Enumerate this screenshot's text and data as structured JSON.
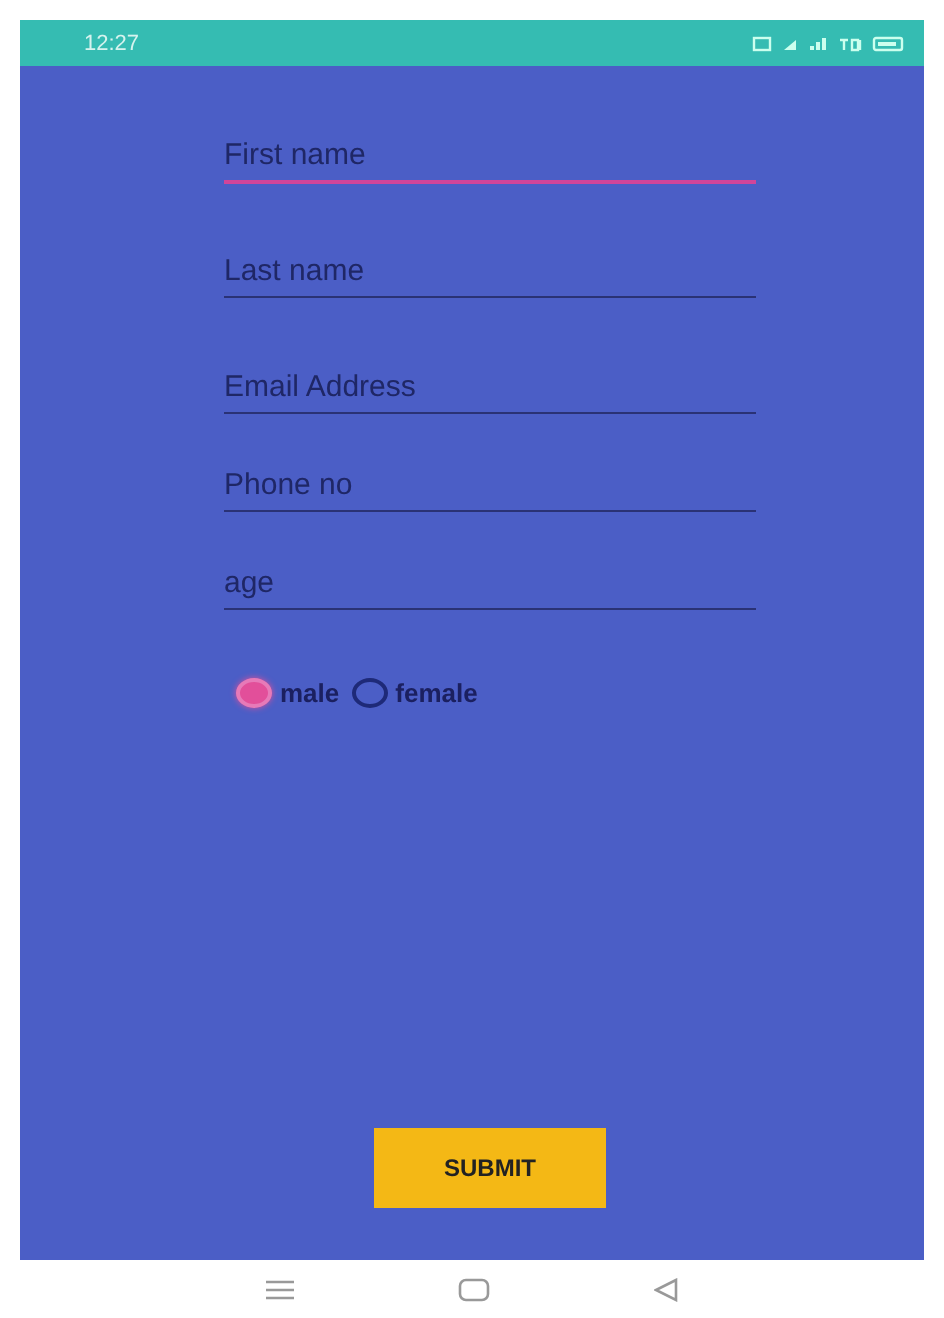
{
  "status_bar": {
    "time": "12:27"
  },
  "fields": [
    {
      "placeholder": "First name",
      "focused": true
    },
    {
      "placeholder": "Last name",
      "focused": false
    },
    {
      "placeholder": "Email Address",
      "focused": false
    },
    {
      "placeholder": "Phone no",
      "focused": false
    },
    {
      "placeholder": "age",
      "focused": false
    }
  ],
  "gender": [
    {
      "label": "male",
      "selected": true
    },
    {
      "label": "female",
      "selected": false
    }
  ],
  "submit": "SUBMIT"
}
